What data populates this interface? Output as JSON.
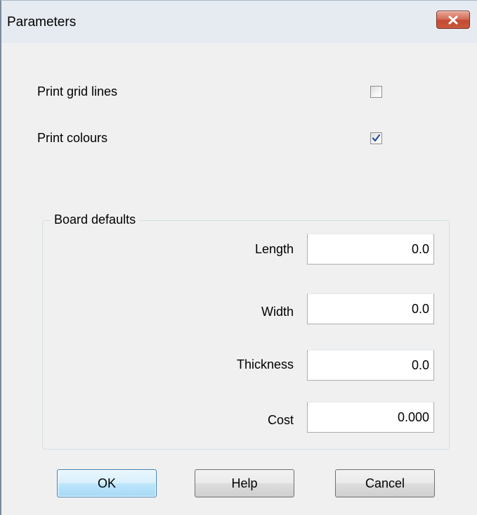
{
  "window": {
    "title": "Parameters",
    "close_icon": "close-icon"
  },
  "options": {
    "print_grid_lines": {
      "label": "Print grid lines",
      "checked": false
    },
    "print_colours": {
      "label": "Print colours",
      "checked": true
    }
  },
  "board_defaults": {
    "legend": "Board defaults",
    "fields": {
      "length": {
        "label": "Length",
        "value": "0.0"
      },
      "width": {
        "label": "Width",
        "value": "0.0"
      },
      "thickness": {
        "label": "Thickness",
        "value": "0.0"
      },
      "cost": {
        "label": "Cost",
        "value": "0.000"
      }
    }
  },
  "buttons": {
    "ok": "OK",
    "help": "Help",
    "cancel": "Cancel"
  },
  "colors": {
    "close_button": "#c95a3f",
    "checkmark": "#2a4ea0",
    "default_button_border": "#3c7fb1"
  }
}
